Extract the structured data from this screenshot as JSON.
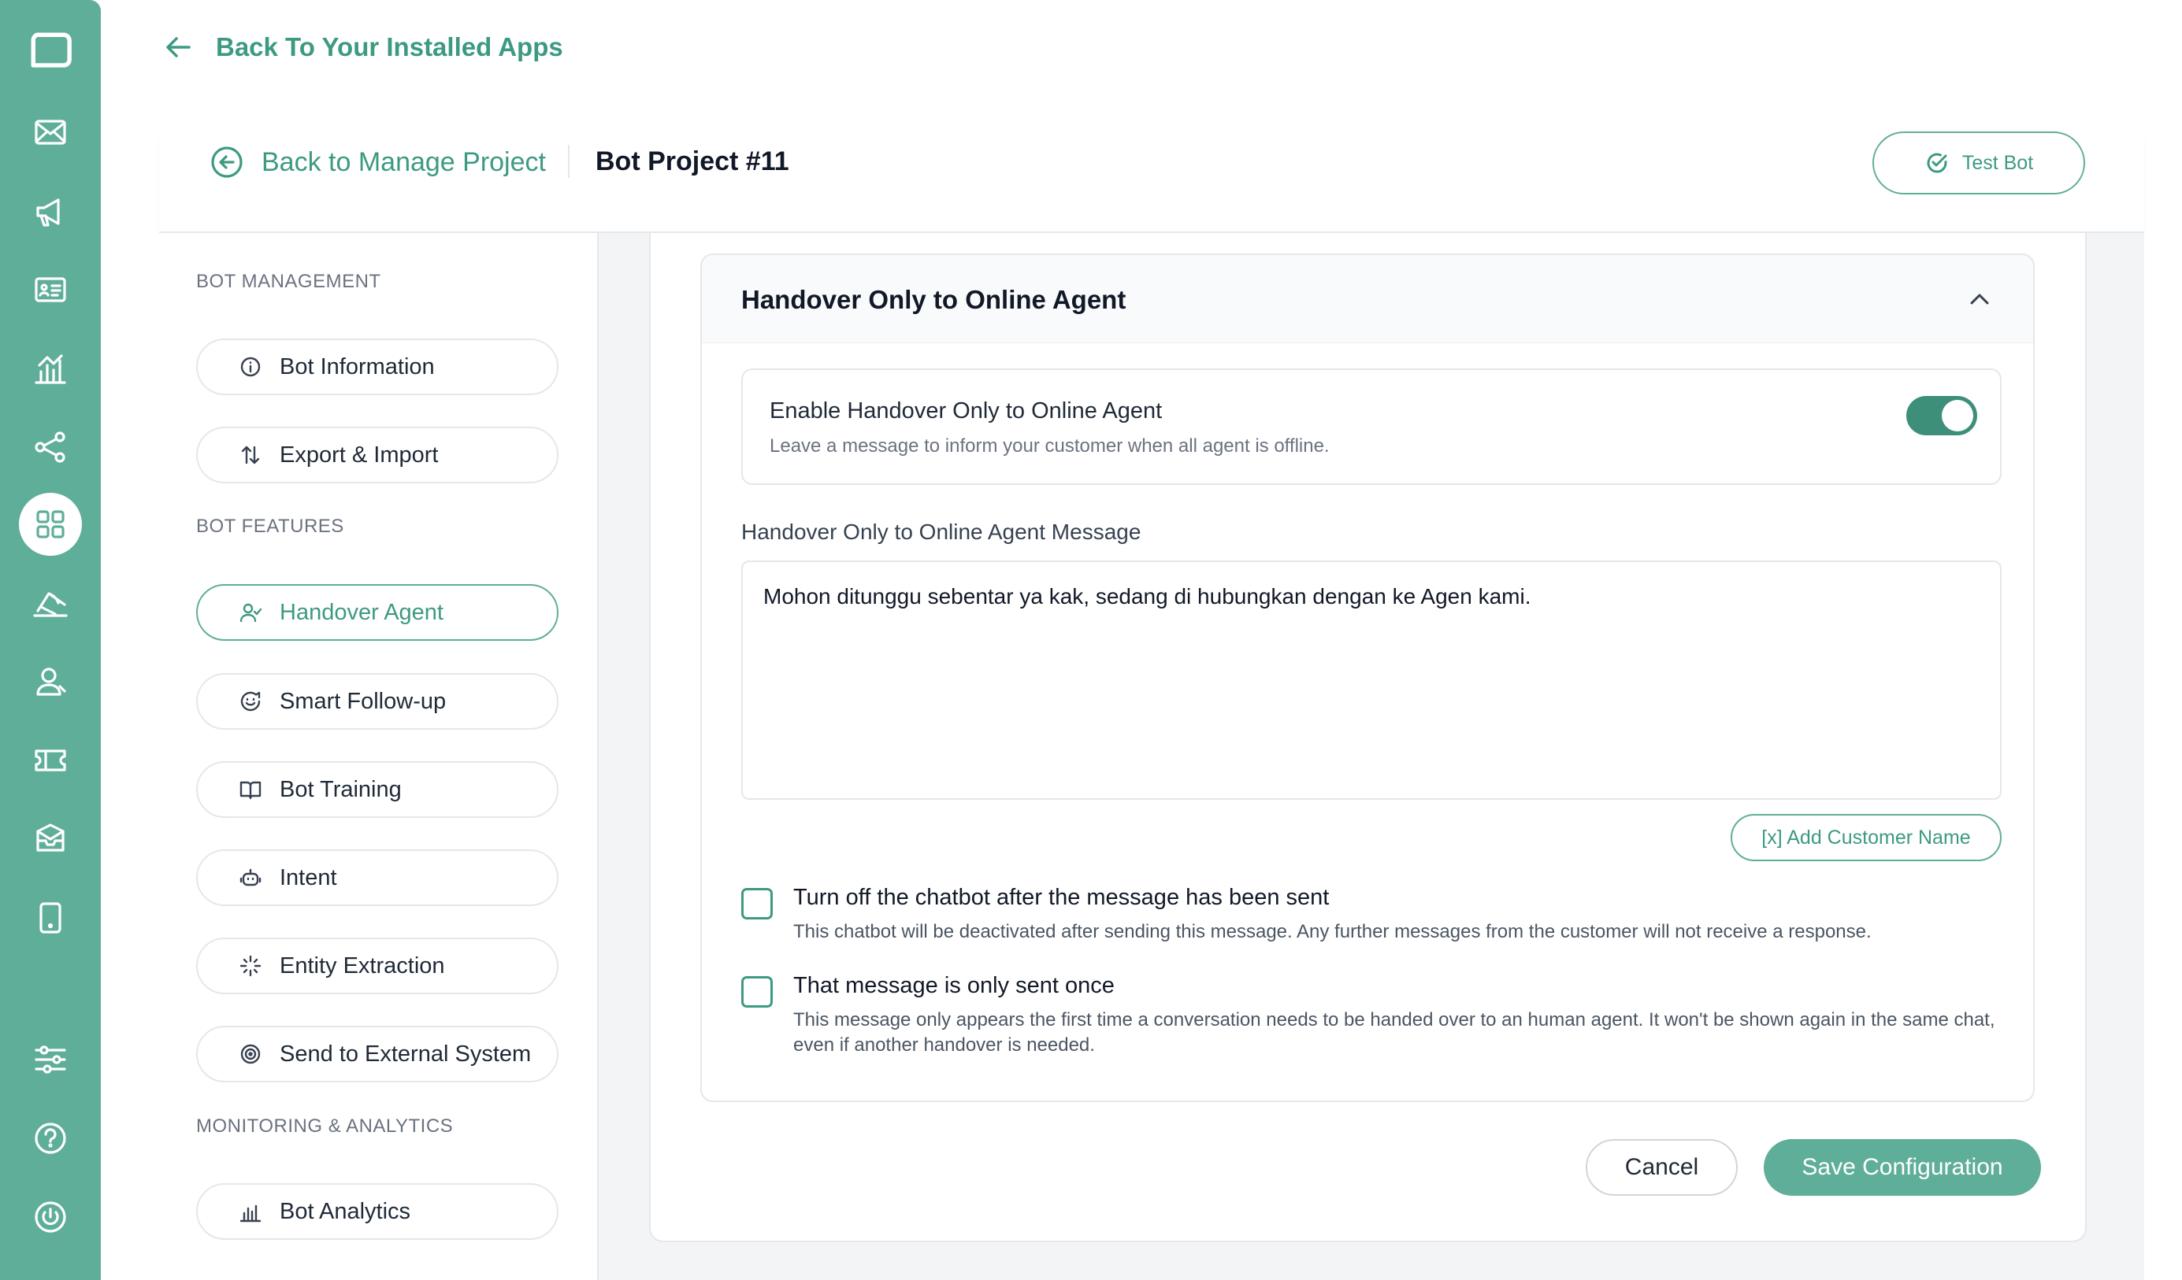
{
  "nav_top": {
    "back_label": "Back To Your Installed Apps"
  },
  "header": {
    "back_label": "Back to Manage Project",
    "project_title": "Bot Project #11",
    "test_bot_label": "Test Bot"
  },
  "rail": {
    "icons": [
      "logo-chat-icon",
      "mail-icon",
      "megaphone-icon",
      "contact-card-icon",
      "analytics-chart-icon",
      "share-nodes-icon",
      "apps-grid-icon",
      "broadcast-icon",
      "agent-user-icon",
      "ticket-icon",
      "inbox-icon",
      "mobile-icon",
      "settings-sliders-icon",
      "help-icon",
      "power-icon"
    ],
    "active": "apps-grid-icon"
  },
  "sidebar": {
    "sections": [
      {
        "label": "BOT MANAGEMENT"
      },
      {
        "label": "BOT FEATURES"
      },
      {
        "label": "MONITORING & ANALYTICS"
      }
    ],
    "items": [
      {
        "label": "Bot Information",
        "icon": "info-icon"
      },
      {
        "label": "Export & Import",
        "icon": "arrows-up-down-icon"
      },
      {
        "label": "Handover Agent",
        "icon": "user-check-icon",
        "active": true
      },
      {
        "label": "Smart Follow-up",
        "icon": "chat-smile-icon"
      },
      {
        "label": "Bot Training",
        "icon": "book-icon"
      },
      {
        "label": "Intent",
        "icon": "robot-icon"
      },
      {
        "label": "Entity Extraction",
        "icon": "sparkle-icon"
      },
      {
        "label": "Send to External System",
        "icon": "target-icon"
      },
      {
        "label": "Bot Analytics",
        "icon": "bar-chart-icon"
      }
    ]
  },
  "main": {
    "section_title": "Handover Only to Online Agent",
    "enable": {
      "title": "Enable Handover Only to Online Agent",
      "subtitle": "Leave a message to inform your customer when all agent is offline.",
      "enabled": true
    },
    "message_label": "Handover Only to Online Agent Message",
    "message_value": "Mohon ditunggu sebentar ya kak, sedang di hubungkan dengan ke Agen kami.",
    "add_customer_name_label": "[x] Add Customer Name",
    "options": [
      {
        "title": "Turn off the chatbot after the message has been sent",
        "description": "This chatbot will be deactivated after sending this message. Any further messages from the customer will not receive a response.",
        "checked": false
      },
      {
        "title": "That message is only sent once",
        "description": "This message only appears the first time a conversation needs to be handed over to an human agent. It won't be shown again in the same chat, even if another handover is needed.",
        "checked": false
      }
    ],
    "cancel_label": "Cancel",
    "save_label": "Save Configuration"
  },
  "colors": {
    "accent": "#5fae99",
    "accent_dark": "#3d9a82",
    "toggle_on": "#3d8f7a"
  }
}
